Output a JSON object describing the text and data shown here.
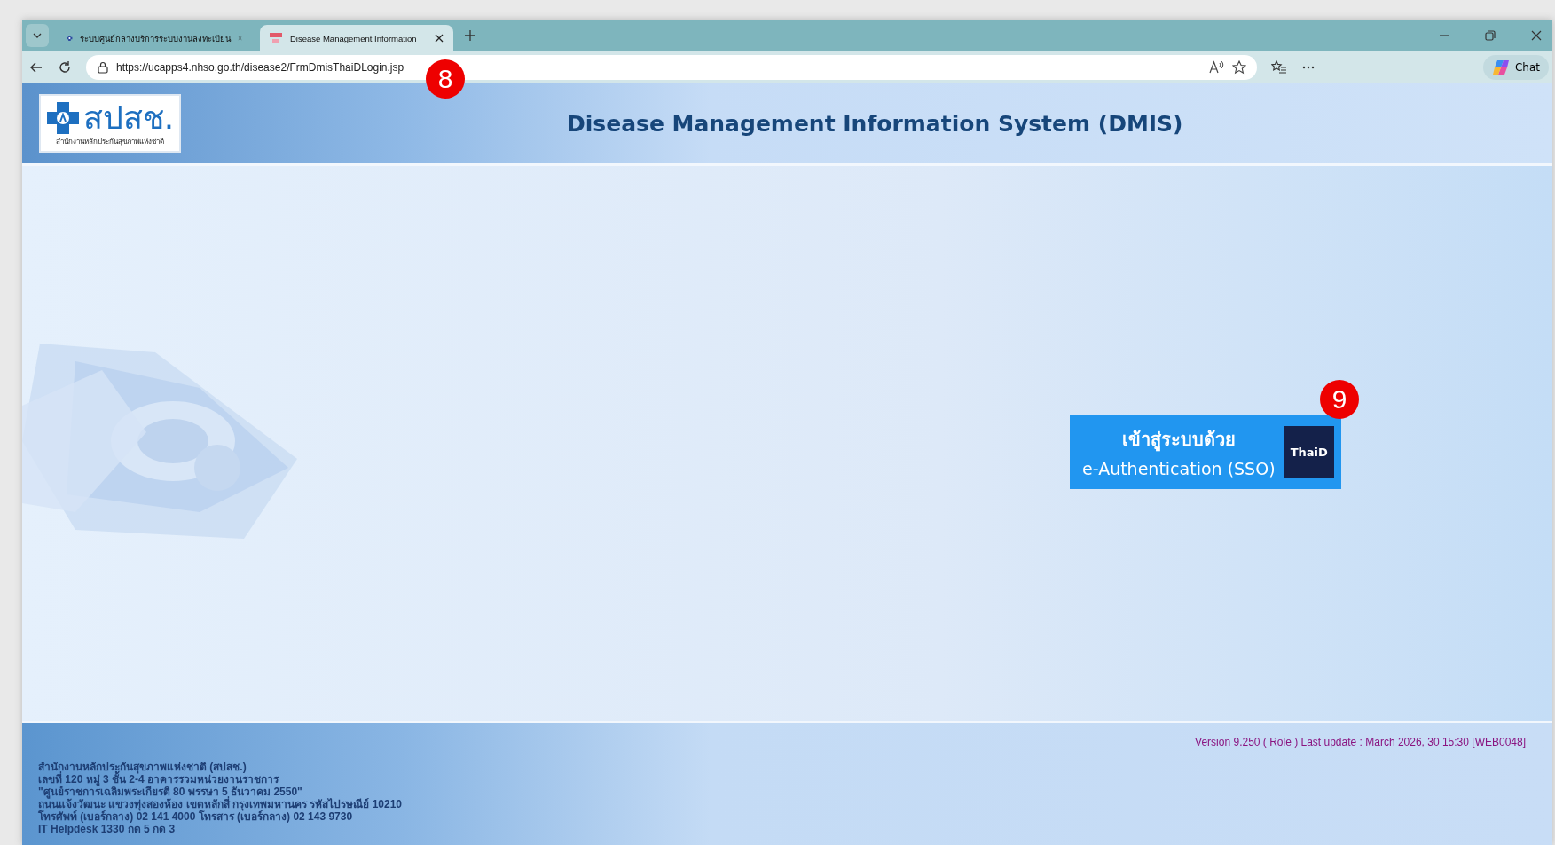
{
  "browser": {
    "tabs": [
      {
        "title": "ระบบศูนย์กลางบริการระบบงานลงทะเบียน",
        "selected": false
      },
      {
        "title": "Disease Management Information",
        "selected": true
      }
    ],
    "url": "https://ucapps4.nhso.go.th/disease2/FrmDmisThaiDLogin.jsp",
    "url_marker": "8",
    "chat_label": "Chat"
  },
  "header": {
    "logo_text": "สปสช.",
    "logo_subtitle": "สำนักงานหลักประกันสุขภาพแห่งชาติ",
    "title": "Disease Management Information System (DMIS)"
  },
  "login_button": {
    "line_1": "เข้าสู่ระบบด้วย",
    "line_2": "e-Authentication (SSO)",
    "badge_text": "ThaiD",
    "marker": "9"
  },
  "footer": {
    "address_lines": [
      "สำนักงานหลักประกันสุขภาพแห่งชาติ (สปสช.)",
      "เลขที่ 120 หมู่ 3 ชั้น 2-4 อาคารรวมหน่วยงานราชการ",
      "\"ศูนย์ราชการเฉลิมพระเกียรติ 80 พรรษา 5 ธันวาคม 2550\"",
      "ถนนแจ้งวัฒนะ แขวงทุ่งสองห้อง เขตหลักสี่ กรุงเทพมหานคร รหัสไปรษณีย์ 10210",
      "โทรศัพท์ (เบอร์กลาง) 02 141 4000 โทรสาร (เบอร์กลาง) 02 143 9730",
      "IT Helpdesk 1330 กด 5 กด 3"
    ],
    "version": "Version 9.250 ( Role )  Last update : March 2026, 30 15:30 [WEB0048]"
  }
}
